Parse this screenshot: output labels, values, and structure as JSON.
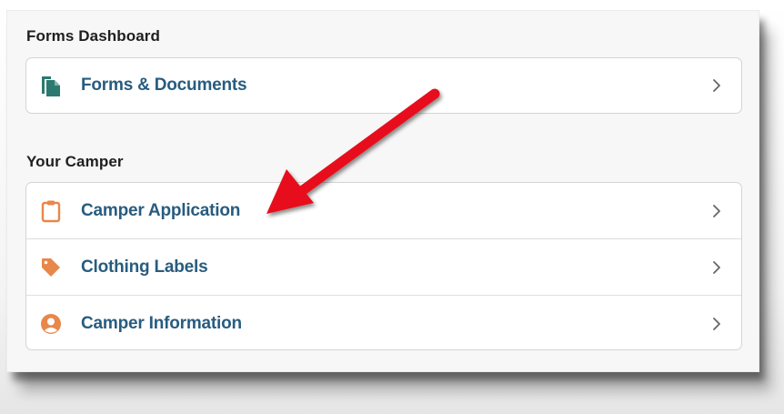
{
  "forms_section": {
    "title": "Forms Dashboard",
    "items": [
      {
        "label": "Forms & Documents",
        "icon": "documents-icon"
      }
    ]
  },
  "camper_section": {
    "title": "Your Camper",
    "items": [
      {
        "label": "Camper Application",
        "icon": "clipboard-icon"
      },
      {
        "label": "Clothing Labels",
        "icon": "tag-icon"
      },
      {
        "label": "Camper Information",
        "icon": "user-circle-icon"
      }
    ]
  },
  "colors": {
    "link_text": "#285c7f",
    "forms_icon": "#2c7a6f",
    "camper_icons": "#e8874a",
    "annotation_arrow": "#e8101a"
  }
}
